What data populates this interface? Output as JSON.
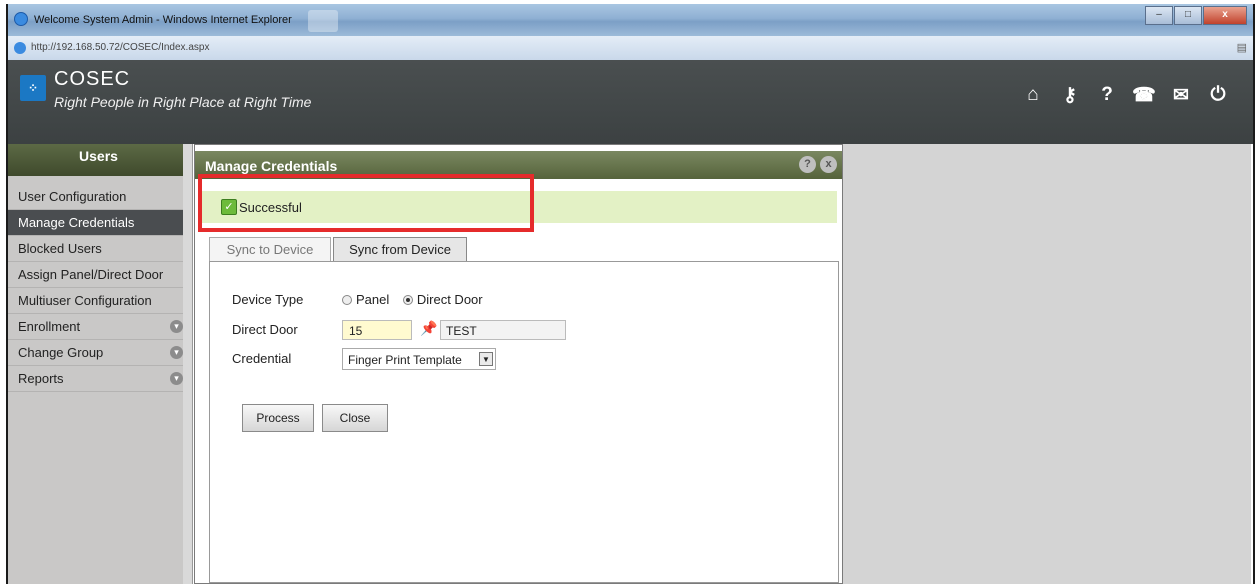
{
  "browser": {
    "window_title": "Welcome System Admin - Windows Internet Explorer",
    "url": "http://192.168.50.72/COSEC/Index.aspx",
    "minimize": "–",
    "maximize": "□",
    "close": "x"
  },
  "header": {
    "brand": "COSEC",
    "tagline": "Right People in Right Place at Right Time",
    "icons": [
      {
        "name": "home-icon",
        "glyph": "⌂"
      },
      {
        "name": "key-icon",
        "glyph": "⚷"
      },
      {
        "name": "help-icon",
        "glyph": "?"
      },
      {
        "name": "phone-icon",
        "glyph": "☎"
      },
      {
        "name": "feedback-icon",
        "glyph": "✉"
      },
      {
        "name": "power-icon",
        "glyph": "⏻"
      }
    ]
  },
  "sidebar": {
    "title": "Users",
    "items": [
      {
        "label": "User Configuration",
        "expandable": false
      },
      {
        "label": "Manage Credentials",
        "expandable": false,
        "active": true
      },
      {
        "label": "Blocked Users",
        "expandable": false
      },
      {
        "label": "Assign Panel/Direct Door",
        "expandable": false
      },
      {
        "label": "Multiuser Configuration",
        "expandable": false
      },
      {
        "label": "Enrollment",
        "expandable": true
      },
      {
        "label": "Change Group",
        "expandable": true
      },
      {
        "label": "Reports",
        "expandable": true
      }
    ]
  },
  "panel": {
    "title": "Manage Credentials",
    "help_button": "?",
    "close_button": "x",
    "message": "Successful",
    "tabs": [
      "Sync to Device",
      "Sync from Device"
    ],
    "active_tab": "Sync from Device",
    "form": {
      "device_type_label": "Device Type",
      "device_type_options": [
        "Panel",
        "Direct Door"
      ],
      "device_type_selected": "Direct Door",
      "direct_door_label": "Direct Door",
      "direct_door_value": "15",
      "direct_door_name": "TEST",
      "credential_label": "Credential",
      "credential_value": "Finger Print Template"
    },
    "buttons": {
      "process": "Process",
      "close": "Close"
    }
  },
  "colors": {
    "header_bg": "#3f4445",
    "panel_header": "#6a774d",
    "success_bg": "#e3f1c5",
    "highlight_border": "#e52b2b"
  }
}
